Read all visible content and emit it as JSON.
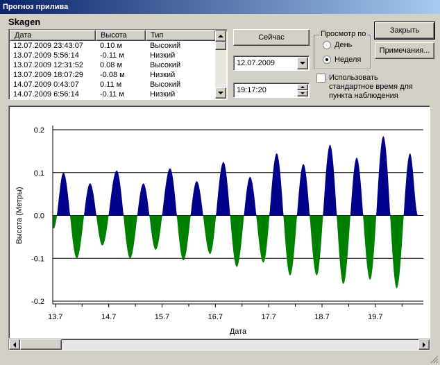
{
  "window": {
    "title": "Прогноз прилива"
  },
  "station": "Skagen",
  "list": {
    "columns": [
      "Дата",
      "Высота",
      "Тип"
    ],
    "rows": [
      [
        "12.07.2009 23:43:07",
        "0.10 м",
        "Высокий"
      ],
      [
        "13.07.2009 5:56:14",
        "-0.11 м",
        "Низкий"
      ],
      [
        "13.07.2009 12:31:52",
        "0.08 м",
        "Высокий"
      ],
      [
        "13.07.2009 18:07:29",
        "-0.08 м",
        "Низкий"
      ],
      [
        "14.07.2009 0:43:07",
        "0.11 м",
        "Высокий"
      ],
      [
        "14.07.2009 6:56:14",
        "-0.11 м",
        "Низкий"
      ]
    ]
  },
  "controls": {
    "now_button": "Сейчас",
    "date_value": "12.07.2009",
    "time_value": "19:17:20",
    "view_group_label": "Просмотр по",
    "radio_day": "День",
    "radio_week": "Неделя",
    "selected_view": "week",
    "close_button": "Закрыть",
    "notes_button": "Примечания...",
    "std_time_checkbox": [
      "Использовать",
      "стандартное время для",
      "пункта наблюдения"
    ],
    "std_time_checked": false
  },
  "colors": {
    "high": "#00008b",
    "low": "#008000",
    "titlebar": "#0a246a"
  },
  "chart_data": {
    "type": "area",
    "xlabel": "Дата",
    "ylabel": "Высота (Метры)",
    "xticks": [
      "13.7",
      "14.7",
      "15.7",
      "16.7",
      "17.7",
      "18.7",
      "19.7"
    ],
    "yticks": [
      "0.2",
      "0.1",
      "0.0",
      "-0.1",
      "-0.2"
    ],
    "ylim": [
      -0.2,
      0.2
    ],
    "x_unit": "days since 12.7",
    "extrema": [
      {
        "t": 0.97,
        "h": -0.03
      },
      {
        "t": 1.15,
        "h": 0.1
      },
      {
        "t": 1.4,
        "h": -0.1
      },
      {
        "t": 1.65,
        "h": 0.075
      },
      {
        "t": 1.88,
        "h": -0.07
      },
      {
        "t": 2.15,
        "h": 0.105
      },
      {
        "t": 2.4,
        "h": -0.1
      },
      {
        "t": 2.65,
        "h": 0.075
      },
      {
        "t": 2.88,
        "h": -0.08
      },
      {
        "t": 3.15,
        "h": 0.11
      },
      {
        "t": 3.4,
        "h": -0.105
      },
      {
        "t": 3.65,
        "h": 0.08
      },
      {
        "t": 3.9,
        "h": -0.09
      },
      {
        "t": 4.15,
        "h": 0.125
      },
      {
        "t": 4.4,
        "h": -0.12
      },
      {
        "t": 4.65,
        "h": 0.09
      },
      {
        "t": 4.9,
        "h": -0.11
      },
      {
        "t": 5.15,
        "h": 0.145
      },
      {
        "t": 5.4,
        "h": -0.14
      },
      {
        "t": 5.65,
        "h": 0.12
      },
      {
        "t": 5.9,
        "h": -0.14
      },
      {
        "t": 6.15,
        "h": 0.165
      },
      {
        "t": 6.4,
        "h": -0.16
      },
      {
        "t": 6.65,
        "h": 0.135
      },
      {
        "t": 6.9,
        "h": -0.15
      },
      {
        "t": 7.15,
        "h": 0.185
      },
      {
        "t": 7.4,
        "h": -0.17
      },
      {
        "t": 7.65,
        "h": 0.145
      },
      {
        "t": 7.8,
        "h": 0.0
      }
    ]
  }
}
